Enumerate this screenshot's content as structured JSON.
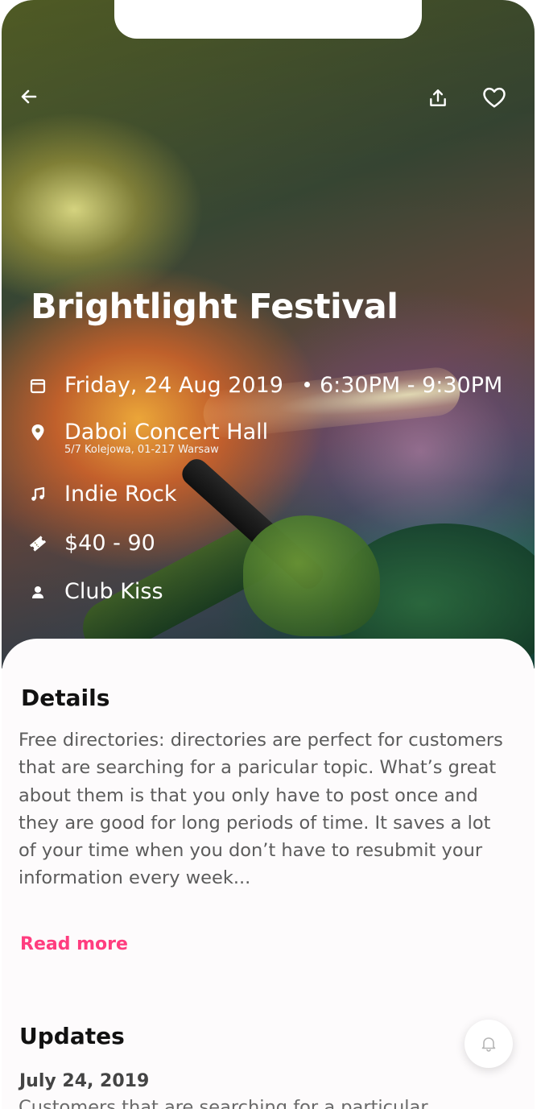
{
  "event": {
    "title": "Brightlight Festival",
    "date": "Friday, 24 Aug 2019",
    "time": "6:30PM - 9:30PM",
    "venue": "Daboi Concert Hall",
    "address": "5/7 Kolejowa, 01-217 Warsaw",
    "genre": "Indie Rock",
    "price": "$40 - 90",
    "organizer": "Club Kiss"
  },
  "details": {
    "heading": "Details",
    "body": "Free directories: directories are perfect for customers that are searching for a paricular topic. What’s great about them is that you only have to post once and they are good for long periods of time. It saves a lot of your time when you don’t have to resubmit your information every week...",
    "read_more": "Read more"
  },
  "updates": {
    "heading": "Updates",
    "items": [
      {
        "date": "July 24, 2019",
        "text": "Customers that are searching for a particular"
      }
    ]
  },
  "icons": {
    "back": "arrow-left-icon",
    "share": "share-icon",
    "favorite": "heart-icon",
    "calendar": "calendar-icon",
    "location": "location-pin-icon",
    "music": "music-note-icon",
    "ticket": "ticket-icon",
    "person": "person-icon",
    "bell": "bell-icon"
  },
  "colors": {
    "accent": "#ff3d7f",
    "heading": "#111111",
    "body_text": "#5c5c5c",
    "sheet_bg": "#fdfbfc"
  }
}
